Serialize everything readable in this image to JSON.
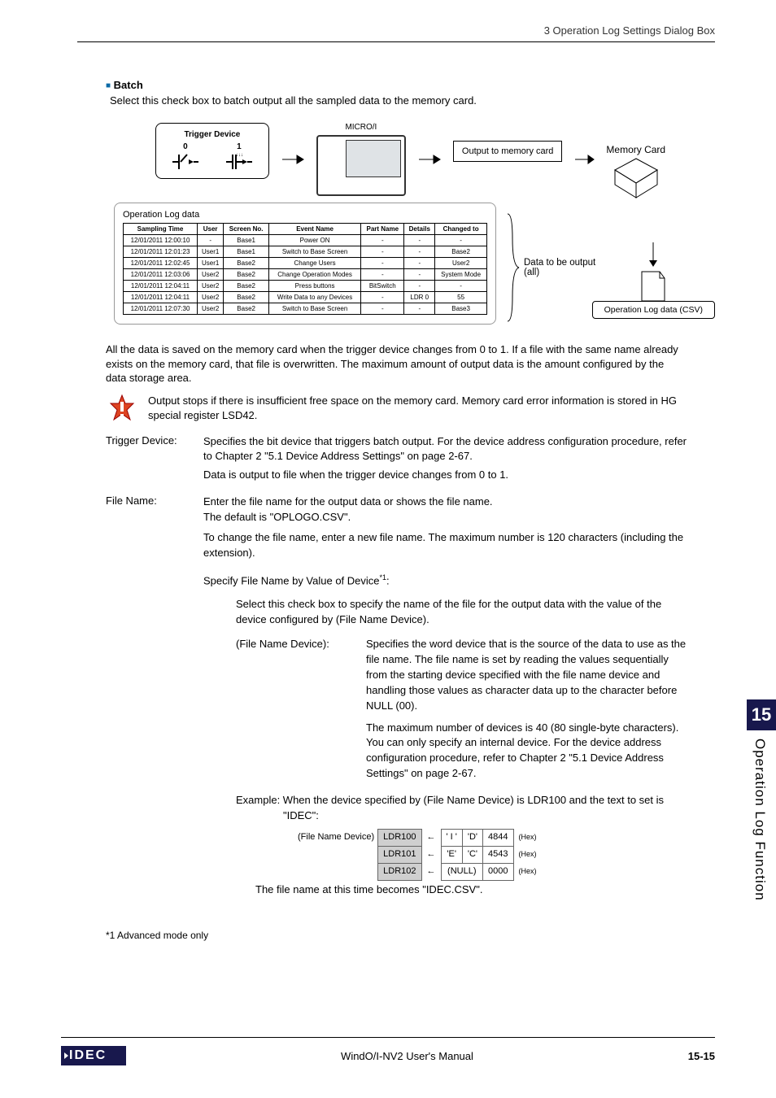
{
  "header": {
    "breadcrumb": "3 Operation Log Settings Dialog Box"
  },
  "batch": {
    "heading": "Batch",
    "intro": "Select this check box to batch output all the sampled data to the memory card."
  },
  "diagram": {
    "trigger_title": "Trigger Device",
    "zero": "0",
    "one": "1",
    "microi": "MICRO/I",
    "output_label": "Output to memory card",
    "memcard_label": "Memory Card",
    "log_title": "Operation Log data",
    "csv_title": "Operation Log data (CSV)",
    "data_output_label": "Data to be output (all)",
    "columns": [
      "Sampling Time",
      "User",
      "Screen No.",
      "Event Name",
      "Part Name",
      "Details",
      "Changed to"
    ],
    "rows": [
      [
        "12/01/2011 12:00:10",
        "-",
        "Base1",
        "Power ON",
        "-",
        "-",
        "-"
      ],
      [
        "12/01/2011 12:01:23",
        "User1",
        "Base1",
        "Switch to Base Screen",
        "-",
        "-",
        "Base2"
      ],
      [
        "12/01/2011 12:02:45",
        "User1",
        "Base2",
        "Change Users",
        "-",
        "-",
        "User2"
      ],
      [
        "12/01/2011 12:03:06",
        "User2",
        "Base2",
        "Change Operation Modes",
        "-",
        "-",
        "System Mode"
      ],
      [
        "12/01/2011 12:04:11",
        "User2",
        "Base2",
        "Press buttons",
        "BitSwitch",
        "-",
        "-"
      ],
      [
        "12/01/2011 12:04:11",
        "User2",
        "Base2",
        "Write Data to any Devices",
        "-",
        "LDR 0",
        "55"
      ],
      [
        "12/01/2011 12:07:30",
        "User2",
        "Base2",
        "Switch to Base Screen",
        "-",
        "-",
        "Base3"
      ]
    ]
  },
  "para1": "All the data is saved on the memory card when the trigger device changes from 0 to 1. If a file with the same name already exists on the memory card, that file is overwritten. The maximum amount of output data is the amount configured by the data storage area.",
  "note": "Output stops if there is insufficient free space on the memory card. Memory card error information is stored in HG special register LSD42.",
  "trigger": {
    "label": "Trigger Device:",
    "l1": "Specifies the bit device that triggers batch output. For the device address configuration procedure, refer to Chapter 2 \"5.1 Device Address Settings\" on page 2-67.",
    "l2": "Data is output to file when the trigger device changes from 0 to 1."
  },
  "filename": {
    "label": "File Name:",
    "l1": "Enter the file name for the output data or shows the file name.",
    "l2": "The default is \"OPLOGO.CSV\".",
    "l3": "To change the file name, enter a new file name. The maximum number is 120 characters (including the extension).",
    "spec_head": "Specify File Name by Value of Device",
    "spec_sup": "*1",
    "spec_colon": ":",
    "spec_body": "Select this check box to specify the name of the file for the output data with the value of the device configured by (File Name Device).",
    "fnd_label": "(File Name Device):",
    "fnd_body1": "Specifies the word device that is the source of the data to use as the file name. The file name is set by reading the values sequentially from the starting device specified with the file name device and handling those values as character data up to the character before NULL (00).",
    "fnd_body2": "The maximum number of devices is 40 (80 single-byte characters). You can only specify an internal device. For the device address configuration procedure, refer to Chapter 2 \"5.1 Device Address Settings\" on page 2-67.",
    "example_head": "Example: When the device specified by (File Name Device) is LDR100 and the text to set is \"IDEC\":",
    "example_foot": "The file name at this time becomes \"IDEC.CSV\".",
    "hex_label": "(File Name Device)",
    "hex_rows": [
      {
        "dev": "LDR100",
        "c1": "' I '",
        "c2": "'D'",
        "hex": "4844",
        "suffix": "(Hex)"
      },
      {
        "dev": "LDR101",
        "c1": "'E'",
        "c2": "'C'",
        "hex": "4543",
        "suffix": "(Hex)"
      },
      {
        "dev": "LDR102",
        "c1": "(NULL)",
        "c2": "",
        "hex": "0000",
        "suffix": "(Hex)"
      }
    ]
  },
  "footnote": "*1  Advanced mode only",
  "footer": {
    "logo": "IDEC",
    "center": "WindO/I-NV2 User's Manual",
    "pagenum": "15-15"
  },
  "sidetab": {
    "num": "15",
    "text": "Operation Log Function"
  }
}
